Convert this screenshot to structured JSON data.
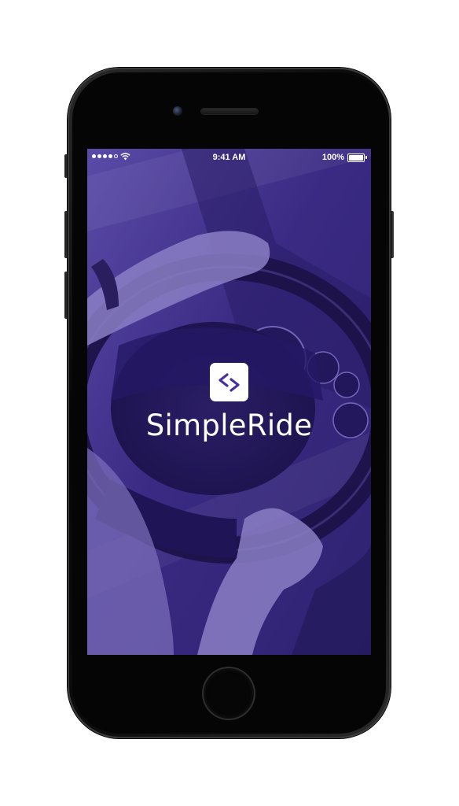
{
  "status_bar": {
    "time": "9:41 AM",
    "battery_percent": "100%",
    "signal_icon": "cellular-signal-icon",
    "wifi_icon": "wifi-icon",
    "battery_icon": "battery-icon"
  },
  "splash": {
    "app_name": "SimpleRide",
    "logo_icon": "code-brackets-logo-icon",
    "overlay_color": "#3b2b82",
    "accent_color": "#4a2fa0"
  },
  "device": {
    "home_button_icon": "home-button"
  }
}
